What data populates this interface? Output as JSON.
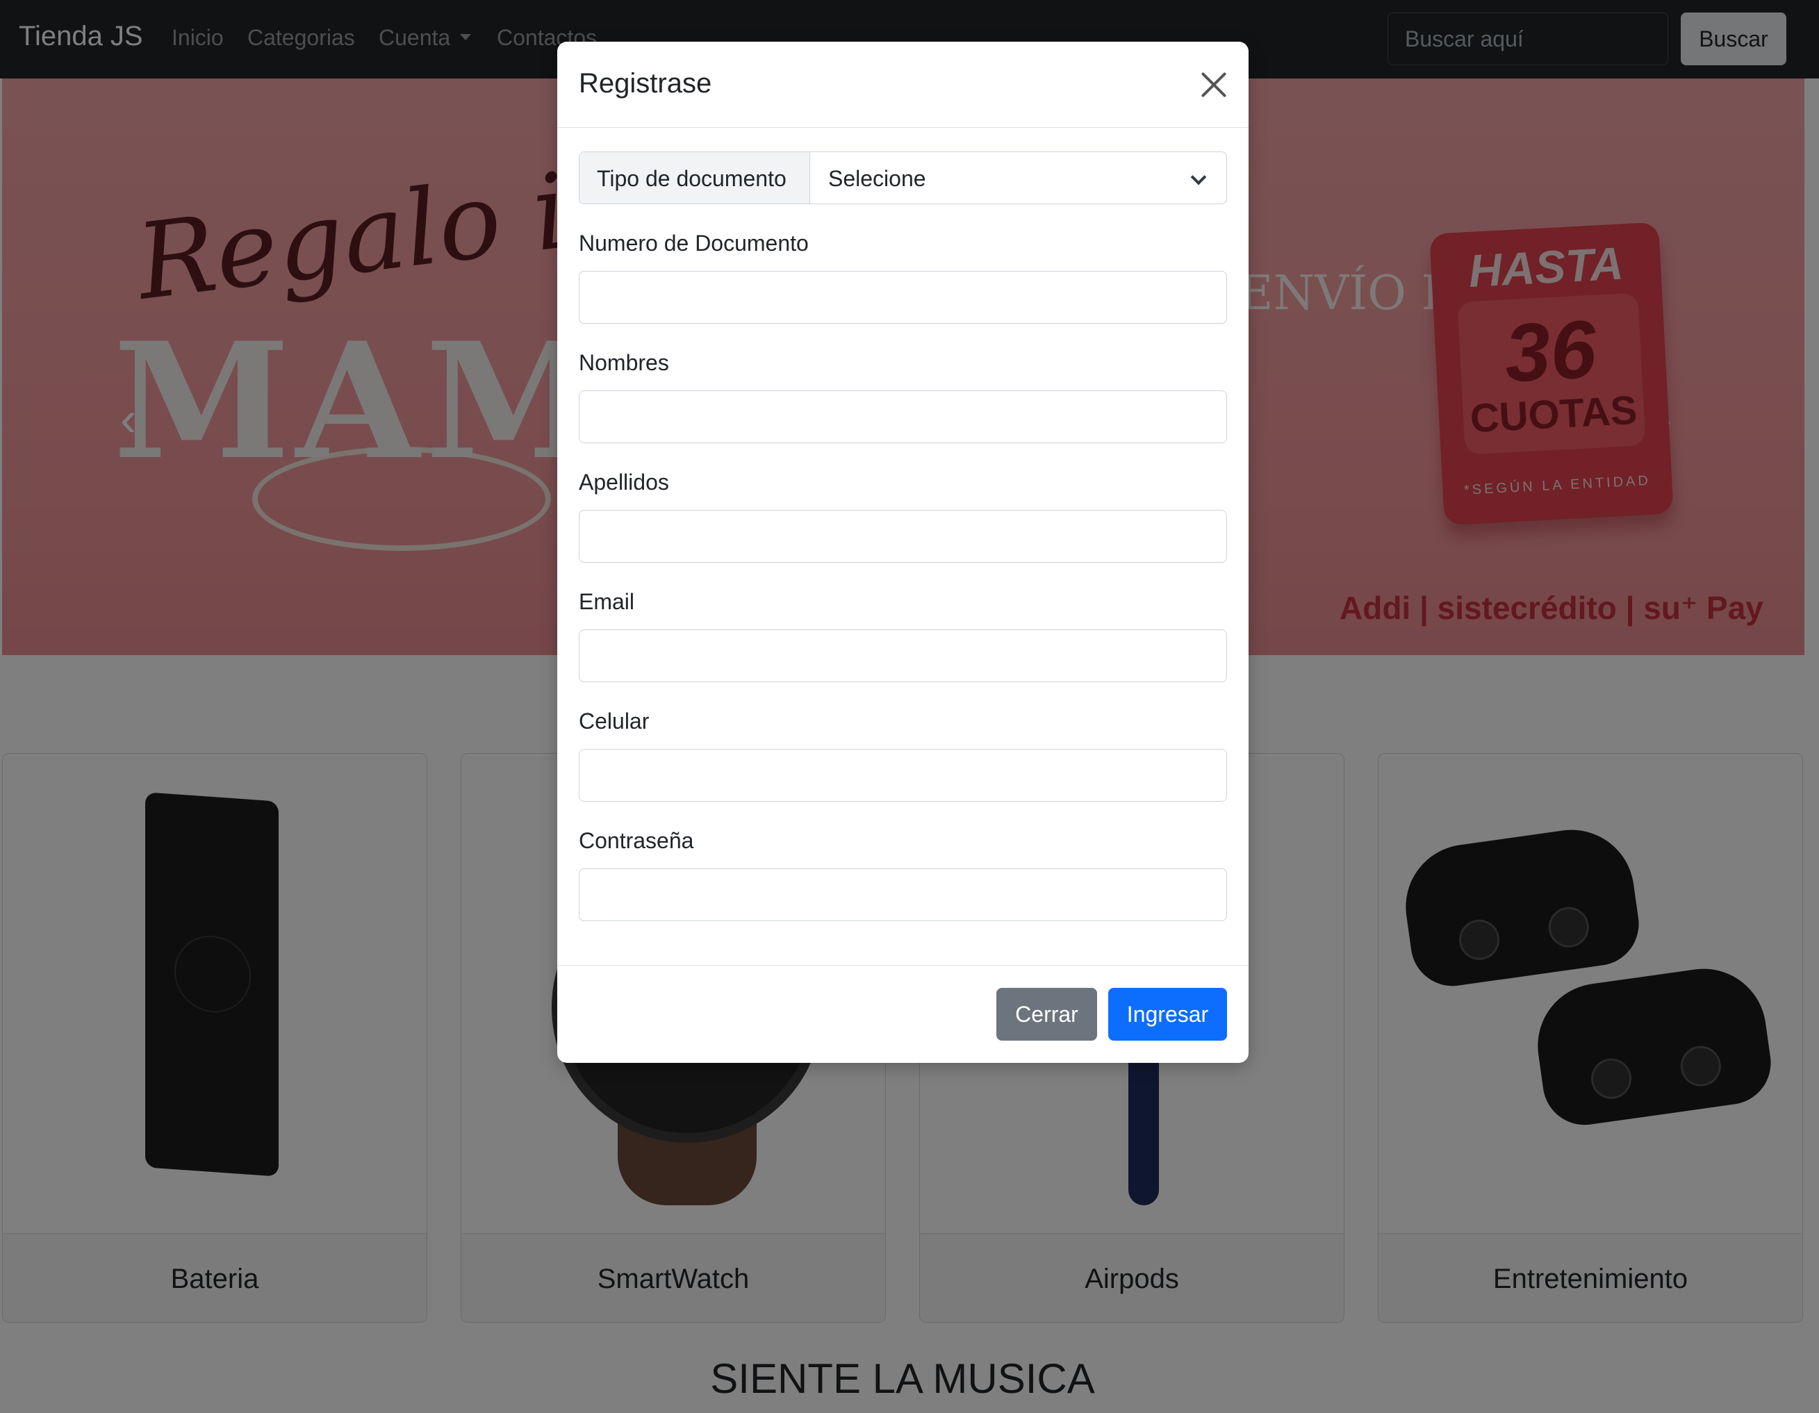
{
  "navbar": {
    "brand": "Tienda JS",
    "links": [
      "Inicio",
      "Categorias",
      "Cuenta",
      "Contactos"
    ],
    "search_placeholder": "Buscar aquí",
    "search_button": "Buscar"
  },
  "hero": {
    "script_text": "Regalo ideal para",
    "headline": "MAMÁ",
    "tagline": "ENVÍO RÁPIDO",
    "badge_top": "HASTA",
    "badge_number": "36",
    "badge_unit": "CUOTAS",
    "badge_note": "*SEGÚN LA ENTIDAD",
    "payments": "Addi | sistecrédito | su⁺ Pay"
  },
  "categories": [
    {
      "label": "Bateria"
    },
    {
      "label": "SmartWatch"
    },
    {
      "label": "Airpods"
    },
    {
      "label": "Entretenimiento"
    }
  ],
  "section_title": "SIENTE LA MUSICA",
  "modal": {
    "title": "Registrase",
    "doc_type_label": "Tipo de documento",
    "doc_type_value": "Selecione",
    "fields": [
      {
        "label": "Numero de Documento",
        "value": ""
      },
      {
        "label": "Nombres",
        "value": ""
      },
      {
        "label": "Apellidos",
        "value": ""
      },
      {
        "label": "Email",
        "value": ""
      },
      {
        "label": "Celular",
        "value": ""
      },
      {
        "label": "Contraseña",
        "value": ""
      }
    ],
    "close_label": "Cerrar",
    "submit_label": "Ingresar"
  },
  "colors": {
    "navbar_bg": "#212529",
    "primary": "#0d6efd",
    "secondary": "#6c757d",
    "hero_pink": "#f29a9d"
  }
}
